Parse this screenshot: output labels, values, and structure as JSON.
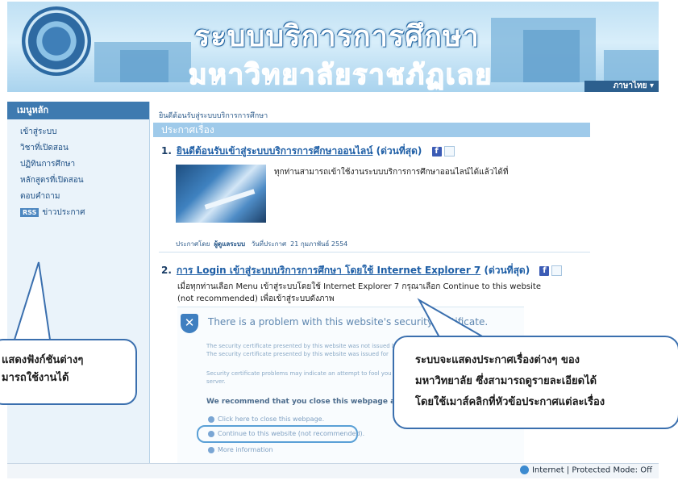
{
  "header": {
    "title": "ระบบบริการการศึกษา",
    "subtitle": "มหาวิทยาลัยราชภัฏเลย",
    "language_label": "ภาษาไทย ▾"
  },
  "sidebar": {
    "heading": "เมนูหลัก",
    "items": [
      {
        "label": "เข้าสู่ระบบ"
      },
      {
        "label": "วิชาที่เปิดสอน"
      },
      {
        "label": "ปฏิทินการศึกษา"
      },
      {
        "label": "หลักสูตรที่เปิดสอน"
      },
      {
        "label": "ตอบคำถาม"
      },
      {
        "label": "ข่าวประกาศ",
        "badge": "RSS"
      }
    ]
  },
  "main": {
    "breadcrumb": "ยินดีต้อนรับสู่ระบบบริการการศึกษา",
    "section_title": "ประกาศเรื่อง",
    "news": [
      {
        "number": "1.",
        "title": "ยินดีต้อนรับเข้าสู่ระบบบริการการศึกษาออนไลน์",
        "tag": "(ด่วนที่สุด)",
        "body": "ทุกท่านสามารถเข้าใช้งานระบบบริการการศึกษาออนไลน์ได้แล้วได้ที่",
        "posted_by_label": "ประกาศโดย",
        "posted_by": "ผู้ดูแลระบบ",
        "date_label": "วันที่ประกาศ",
        "date": "21 กุมภาพันธ์ 2554"
      },
      {
        "number": "2.",
        "title": "การ Login เข้าสู่ระบบบริการการศึกษา โดยใช้ Internet Explorer 7",
        "tag": "(ด่วนที่สุด)",
        "body": "เมื่อทุกท่านเลือก Menu เข้าสู่ระบบโดยใช้ Internet Explorer 7 กรุณาเลือก Continue to this website (not recommended) เพื่อเข้าสู่ระบบดังภาพ"
      }
    ],
    "certificate": {
      "problem": "There is a problem with this website's security certificate.",
      "line1": "The security certificate presented by this website was not issued by",
      "line2": "The security certificate presented by this website was issued for",
      "line3": "Security certificate problems may indicate an attempt to fool you",
      "line4": "server.",
      "recommend": "We recommend that you close this webpage and do not c",
      "opt_close": "Click here to close this webpage.",
      "opt_continue": "Continue to this website (not recommended).",
      "opt_more": "More information"
    }
  },
  "callouts": {
    "left_line1": "แสดงฟังก์ชันต่างๆ",
    "left_line2": "มารถใช้งานได้",
    "right_line1": "ระบบจะแสดงประกาศเรื่องต่างๆ ของ",
    "right_line2": "มหาวิทยาลัย ซึ่งสามารถดูรายละเอียดได้",
    "right_line3": "โดยใช้เมาส์คลิกที่หัวข้อประกาศแต่ละเรื่อง"
  },
  "statusbar": {
    "text": "Internet | Protected Mode: Off"
  },
  "colors": {
    "menu_header": "#3e7ab0",
    "section_bar": "#9fcaea",
    "link": "#1f5fa6"
  }
}
